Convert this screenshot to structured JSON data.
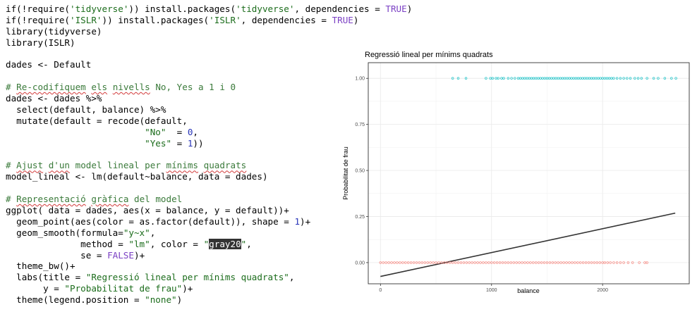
{
  "code": {
    "lines": [
      [
        {
          "t": "if(!require("
        },
        {
          "t": "'tidyverse'",
          "c": "str"
        },
        {
          "t": ")) install.packages("
        },
        {
          "t": "'tidyverse'",
          "c": "str"
        },
        {
          "t": ", dependencies = "
        },
        {
          "t": "TRUE",
          "c": "kw"
        },
        {
          "t": ")"
        }
      ],
      [
        {
          "t": "if(!require("
        },
        {
          "t": "'ISLR'",
          "c": "str"
        },
        {
          "t": ")) install.packages("
        },
        {
          "t": "'ISLR'",
          "c": "str"
        },
        {
          "t": ", dependencies = "
        },
        {
          "t": "TRUE",
          "c": "kw"
        },
        {
          "t": ")"
        }
      ],
      [
        {
          "t": "library(tidyverse)"
        }
      ],
      [
        {
          "t": "library(ISLR)"
        }
      ],
      [],
      [
        {
          "t": "dades <- Default"
        }
      ],
      [],
      [
        {
          "t": "# ",
          "c": "cmt"
        },
        {
          "t": "Re-codifiquem",
          "c": "cmt sq"
        },
        {
          "t": " ",
          "c": "cmt"
        },
        {
          "t": "els",
          "c": "cmt sq"
        },
        {
          "t": " ",
          "c": "cmt"
        },
        {
          "t": "nivells",
          "c": "cmt sq"
        },
        {
          "t": " No, Yes a 1 i 0",
          "c": "cmt"
        }
      ],
      [
        {
          "t": "dades <- dades %>%"
        }
      ],
      [
        {
          "t": "  select(default, balance) %>%"
        }
      ],
      [
        {
          "t": "  mutate(default = recode(default,"
        }
      ],
      [
        {
          "t": "                          "
        },
        {
          "t": "\"No\"",
          "c": "str"
        },
        {
          "t": "  = "
        },
        {
          "t": "0",
          "c": "num"
        },
        {
          "t": ","
        }
      ],
      [
        {
          "t": "                          "
        },
        {
          "t": "\"Yes\"",
          "c": "str"
        },
        {
          "t": " = "
        },
        {
          "t": "1",
          "c": "num"
        },
        {
          "t": "))"
        }
      ],
      [],
      [
        {
          "t": "# ",
          "c": "cmt"
        },
        {
          "t": "Ajust",
          "c": "cmt sq"
        },
        {
          "t": " ",
          "c": "cmt"
        },
        {
          "t": "d'un",
          "c": "cmt sq"
        },
        {
          "t": " model lineal per ",
          "c": "cmt"
        },
        {
          "t": "mínims",
          "c": "cmt sq"
        },
        {
          "t": " ",
          "c": "cmt"
        },
        {
          "t": "quadrats",
          "c": "cmt sq"
        }
      ],
      [
        {
          "t": "model_lineal <- lm(default~balance, data = dades)"
        }
      ],
      [],
      [
        {
          "t": "# ",
          "c": "cmt"
        },
        {
          "t": "Representació",
          "c": "cmt sq"
        },
        {
          "t": " ",
          "c": "cmt"
        },
        {
          "t": "gràfica",
          "c": "cmt sq"
        },
        {
          "t": " del model",
          "c": "cmt"
        }
      ],
      [
        {
          "t": "ggplot( data = dades, aes(x = balance, y = default))+"
        }
      ],
      [
        {
          "t": "  geom_point(aes(color = as.factor(default)), shape = "
        },
        {
          "t": "1",
          "c": "num"
        },
        {
          "t": ")+"
        }
      ],
      [
        {
          "t": "  geom_smooth(formula="
        },
        {
          "t": "\"y~x\"",
          "c": "str"
        },
        {
          "t": ","
        }
      ],
      [
        {
          "t": "              method = "
        },
        {
          "t": "\"lm\"",
          "c": "str"
        },
        {
          "t": ", color = "
        },
        {
          "t": "\"",
          "c": "str"
        },
        {
          "t": "gray20",
          "c": "hl"
        },
        {
          "t": "\"",
          "c": "str"
        },
        {
          "t": ","
        }
      ],
      [
        {
          "t": "              se = "
        },
        {
          "t": "FALSE",
          "c": "kw"
        },
        {
          "t": ")+"
        }
      ],
      [
        {
          "t": "  theme_bw()+"
        }
      ],
      [
        {
          "t": "  labs(title = "
        },
        {
          "t": "\"Regressió lineal per mínims quadrats\"",
          "c": "str"
        },
        {
          "t": ","
        }
      ],
      [
        {
          "t": "       y = "
        },
        {
          "t": "\"Probabilitat de frau\"",
          "c": "str"
        },
        {
          "t": ")+"
        }
      ],
      [
        {
          "t": "  theme(legend.position = "
        },
        {
          "t": "\"none\"",
          "c": "str"
        },
        {
          "t": ")"
        }
      ]
    ]
  },
  "chart_data": {
    "type": "scatter",
    "title": "Regressió lineal per mínims quadrats",
    "xlabel": "balance",
    "ylabel": "Probabilitat de frau",
    "xlim": [
      -110,
      2780
    ],
    "ylim": [
      -0.115,
      1.085
    ],
    "xticks": [
      0,
      1000,
      2000
    ],
    "xtick_labels": [
      "0",
      "1000",
      "2000"
    ],
    "yticks": [
      0,
      0.25,
      0.5,
      0.75,
      1
    ],
    "ytick_labels": [
      "0.00",
      "0.25",
      "0.50",
      "0.75",
      "1.00"
    ],
    "grid": true,
    "legend": "none",
    "series": [
      {
        "y": 0,
        "color": "#f8766d",
        "x": [
          0,
          25,
          50,
          75,
          100,
          125,
          150,
          175,
          200,
          225,
          250,
          275,
          300,
          325,
          350,
          375,
          400,
          425,
          450,
          475,
          500,
          525,
          550,
          575,
          600,
          625,
          650,
          675,
          700,
          725,
          750,
          775,
          800,
          825,
          850,
          875,
          900,
          925,
          950,
          975,
          1000,
          1025,
          1050,
          1075,
          1100,
          1125,
          1150,
          1175,
          1200,
          1225,
          1250,
          1275,
          1300,
          1325,
          1350,
          1375,
          1400,
          1425,
          1450,
          1475,
          1500,
          1525,
          1550,
          1575,
          1600,
          1625,
          1650,
          1675,
          1700,
          1725,
          1750,
          1775,
          1800,
          1825,
          1850,
          1875,
          1900,
          1925,
          1950,
          1975,
          2000,
          2020,
          2045,
          2070,
          2100,
          2130,
          2160,
          2190,
          2230,
          2270,
          2330,
          2380,
          2400
        ]
      },
      {
        "y": 1,
        "color": "#00bfc4",
        "x": [
          650,
          700,
          770,
          950,
          990,
          1010,
          1040,
          1060,
          1090,
          1110,
          1150,
          1180,
          1210,
          1240,
          1260,
          1280,
          1300,
          1320,
          1340,
          1360,
          1380,
          1400,
          1420,
          1440,
          1460,
          1480,
          1500,
          1520,
          1540,
          1560,
          1580,
          1600,
          1620,
          1640,
          1660,
          1680,
          1700,
          1720,
          1740,
          1760,
          1780,
          1800,
          1820,
          1840,
          1860,
          1880,
          1900,
          1920,
          1940,
          1960,
          1980,
          2000,
          2020,
          2040,
          2060,
          2080,
          2100,
          2130,
          2160,
          2190,
          2220,
          2250,
          2290,
          2320,
          2350,
          2400,
          2460,
          2500,
          2560,
          2620,
          2660
        ]
      }
    ],
    "fit_line": {
      "color": "#333333",
      "x": [
        0,
        2654
      ],
      "y": [
        -0.0752,
        0.2686
      ]
    }
  }
}
